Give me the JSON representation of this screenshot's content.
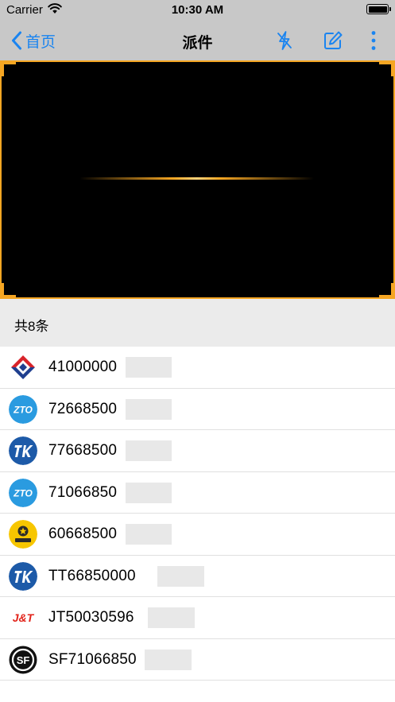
{
  "status_bar": {
    "carrier": "Carrier",
    "time": "10:30 AM"
  },
  "nav": {
    "back_label": "首页",
    "title": "派件",
    "actions": [
      "flash-off-icon",
      "edit-icon",
      "more-vertical-icon"
    ],
    "accent_color": "#1a84f0"
  },
  "scanner": {
    "frame_color": "#f5a623",
    "background": "#000000"
  },
  "list_header": {
    "count_label": "共8条"
  },
  "parcels": [
    {
      "courier_icon": "courier-logo-red-blue-diamond-icon",
      "tracking": "41000000"
    },
    {
      "courier_icon": "zto-logo-icon",
      "tracking": "72668500"
    },
    {
      "courier_icon": "tk-logo-icon",
      "tracking": "77668500"
    },
    {
      "courier_icon": "zto-logo-icon",
      "tracking": "71066850"
    },
    {
      "courier_icon": "yunda-logo-icon",
      "tracking": "60668500"
    },
    {
      "courier_icon": "tk-logo-icon",
      "tracking": "TT66850000"
    },
    {
      "courier_icon": "jt-logo-icon",
      "tracking": "JT50030596"
    },
    {
      "courier_icon": "sf-logo-icon",
      "tracking": "SF71066850"
    }
  ]
}
